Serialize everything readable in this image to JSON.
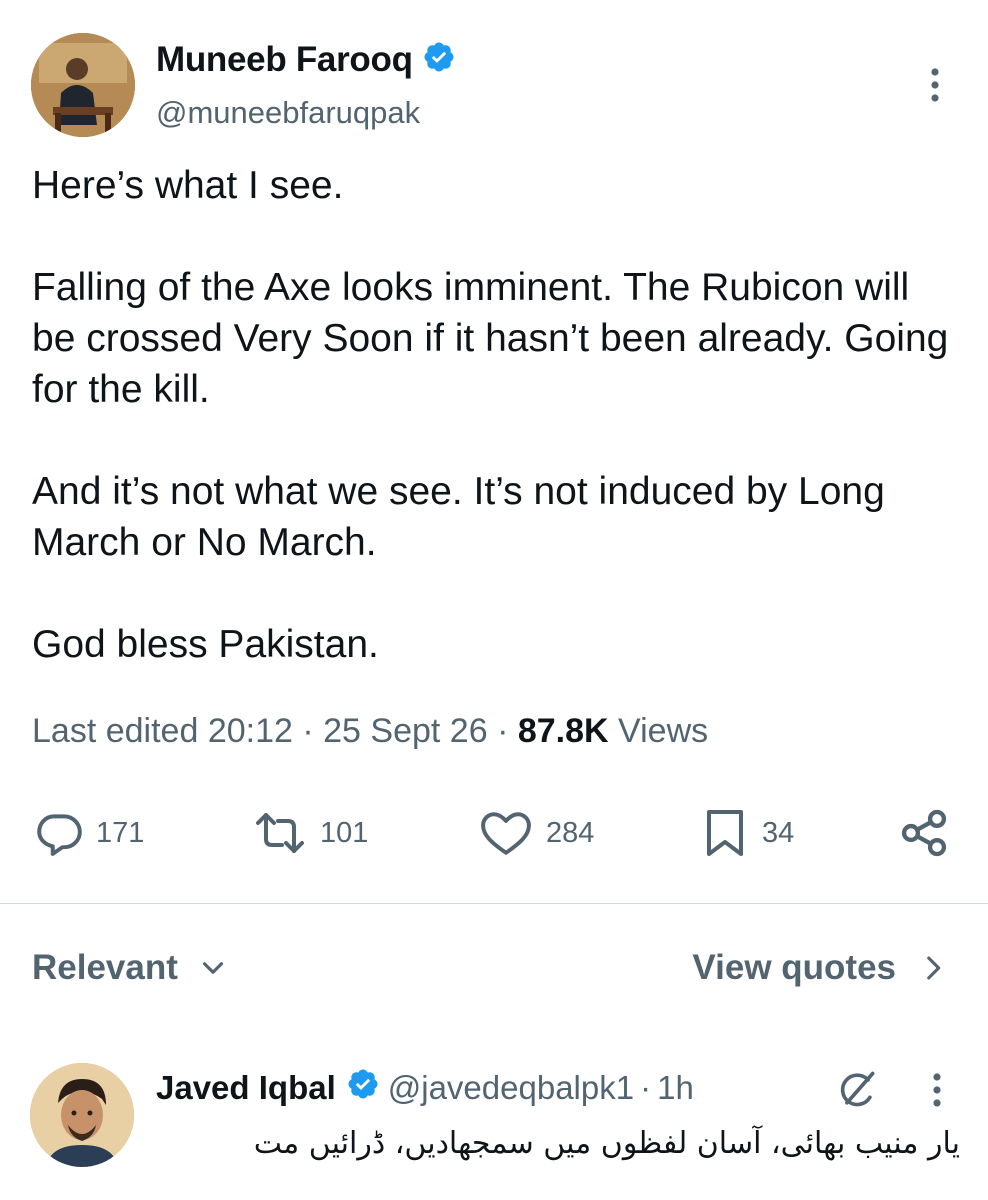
{
  "colors": {
    "accent": "#1d9bf0",
    "text": "#0f1419",
    "muted": "#536471",
    "divider": "#cfd9de"
  },
  "tweet": {
    "author_name": "Muneeb Farooq",
    "author_handle": "@muneebfaruqpak",
    "verified_icon": "verified-badge-icon",
    "more_icon": "more-vertical-icon",
    "paragraphs": [
      "Here’s what I see.",
      "Falling of the Axe looks imminent. The Rubicon will be crossed Very Soon if it hasn’t been already. Going for the kill.",
      "And it’s not what we see. It’s not induced by Long March or No March.",
      "God bless Pakistan."
    ],
    "meta": {
      "edited_prefix": "Last edited",
      "time": "20:12",
      "separator": "·",
      "date": "25 Sept 26",
      "views_count": "87.8K",
      "views_label": "Views"
    },
    "actions": {
      "replies": "171",
      "retweets": "101",
      "likes": "284",
      "bookmarks": "34"
    }
  },
  "replies_bar": {
    "sort_label": "Relevant",
    "view_quotes_label": "View quotes"
  },
  "reply": {
    "author_name": "Javed Iqbal",
    "author_handle": "@javedeqbalpk1",
    "separator": "·",
    "time": "1h",
    "text": "یار منیب بھائی، آسان لفظوں میں سمجھادیں، ڈرائیں مت"
  }
}
